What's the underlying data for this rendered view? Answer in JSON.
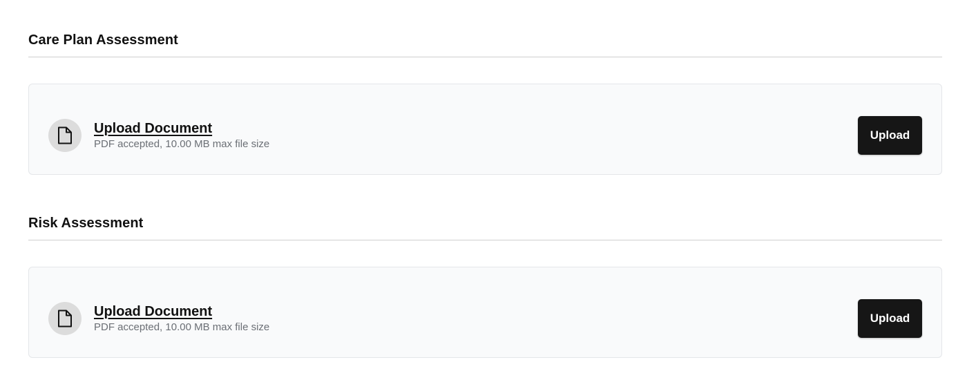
{
  "sections": [
    {
      "title": "Care Plan Assessment",
      "upload": {
        "link_label": "Upload Document",
        "hint": "PDF accepted, 10.00 MB max file size",
        "icon": "document-icon",
        "button_label": "Upload"
      }
    },
    {
      "title": "Risk Assessment",
      "upload": {
        "link_label": "Upload Document",
        "hint": "PDF accepted, 10.00 MB max file size",
        "icon": "document-icon",
        "button_label": "Upload"
      }
    }
  ],
  "colors": {
    "button_bg": "#161616",
    "card_bg": "#f9fafb",
    "icon_circle_bg": "#dcdcdc",
    "hint_text": "#6b6f75"
  }
}
